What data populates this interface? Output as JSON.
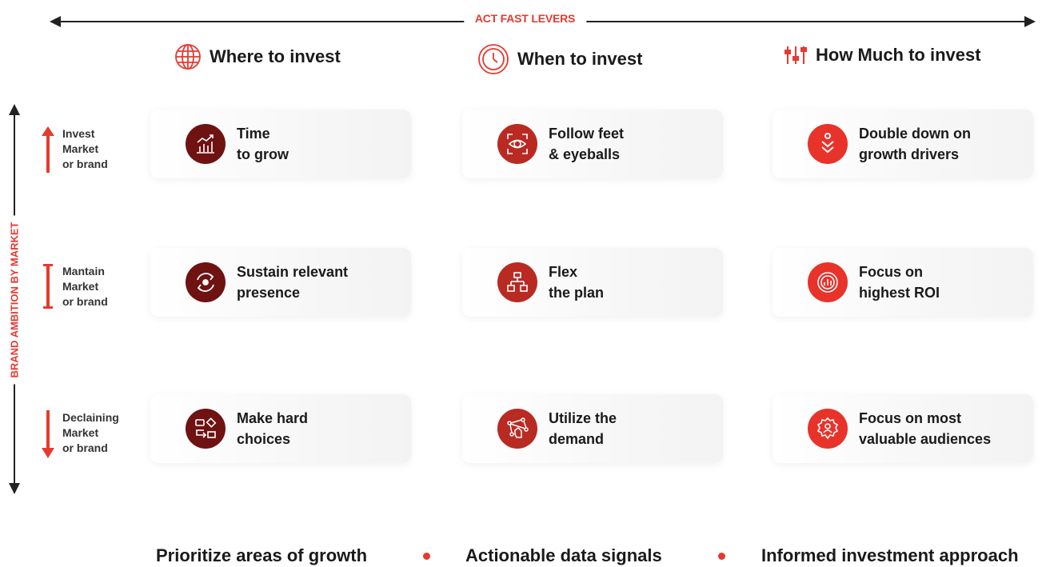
{
  "header": {
    "title": "ACT FAST LEVERS"
  },
  "axis": {
    "vertical_label": "BRAND AMBITION BY MARKET"
  },
  "columns": [
    {
      "label": "Where to invest",
      "icon": "globe-icon"
    },
    {
      "label": "When to invest",
      "icon": "clock-icon"
    },
    {
      "label": "How Much to invest",
      "icon": "sliders-icon"
    }
  ],
  "rows": [
    {
      "line1": "Invest",
      "line2": "Market",
      "line3": "or brand",
      "icon": "arrow-up-icon"
    },
    {
      "line1": "Mantain",
      "line2": "Market",
      "line3": "or brand",
      "icon": "bar-icon"
    },
    {
      "line1": "Declaining",
      "line2": "Market",
      "line3": "or brand",
      "icon": "arrow-down-icon"
    }
  ],
  "cards": {
    "r0c0": {
      "line1": "Time",
      "line2": "to grow",
      "icon": "growth-chart-icon"
    },
    "r0c1": {
      "line1": "Follow feet",
      "line2": "& eyeballs",
      "icon": "eye-scan-icon"
    },
    "r0c2": {
      "line1": "Double down on",
      "line2": "growth drivers",
      "icon": "double-chevron-down-icon"
    },
    "r1c0": {
      "line1": "Sustain relevant",
      "line2": "presence",
      "icon": "cycle-icon"
    },
    "r1c1": {
      "line1": "Flex",
      "line2": "the plan",
      "icon": "flowchart-icon"
    },
    "r1c2": {
      "line1": "Focus on",
      "line2": "highest ROI",
      "icon": "target-chart-icon"
    },
    "r2c0": {
      "line1": "Make hard",
      "line2": "choices",
      "icon": "decision-icon"
    },
    "r2c1": {
      "line1": "Utilize the",
      "line2": "demand",
      "icon": "network-hand-icon"
    },
    "r2c2": {
      "line1": "Focus on most",
      "line2": "valuable audiences",
      "icon": "audience-gear-icon"
    }
  },
  "footer": {
    "items": [
      "Prioritize areas of growth",
      "Actionable data signals",
      "Informed investment approach"
    ]
  },
  "colors": {
    "accent": "#e53a2f",
    "dark_red": "#6e1212",
    "mid_red": "#b92a22",
    "bright_red": "#e8332a"
  }
}
